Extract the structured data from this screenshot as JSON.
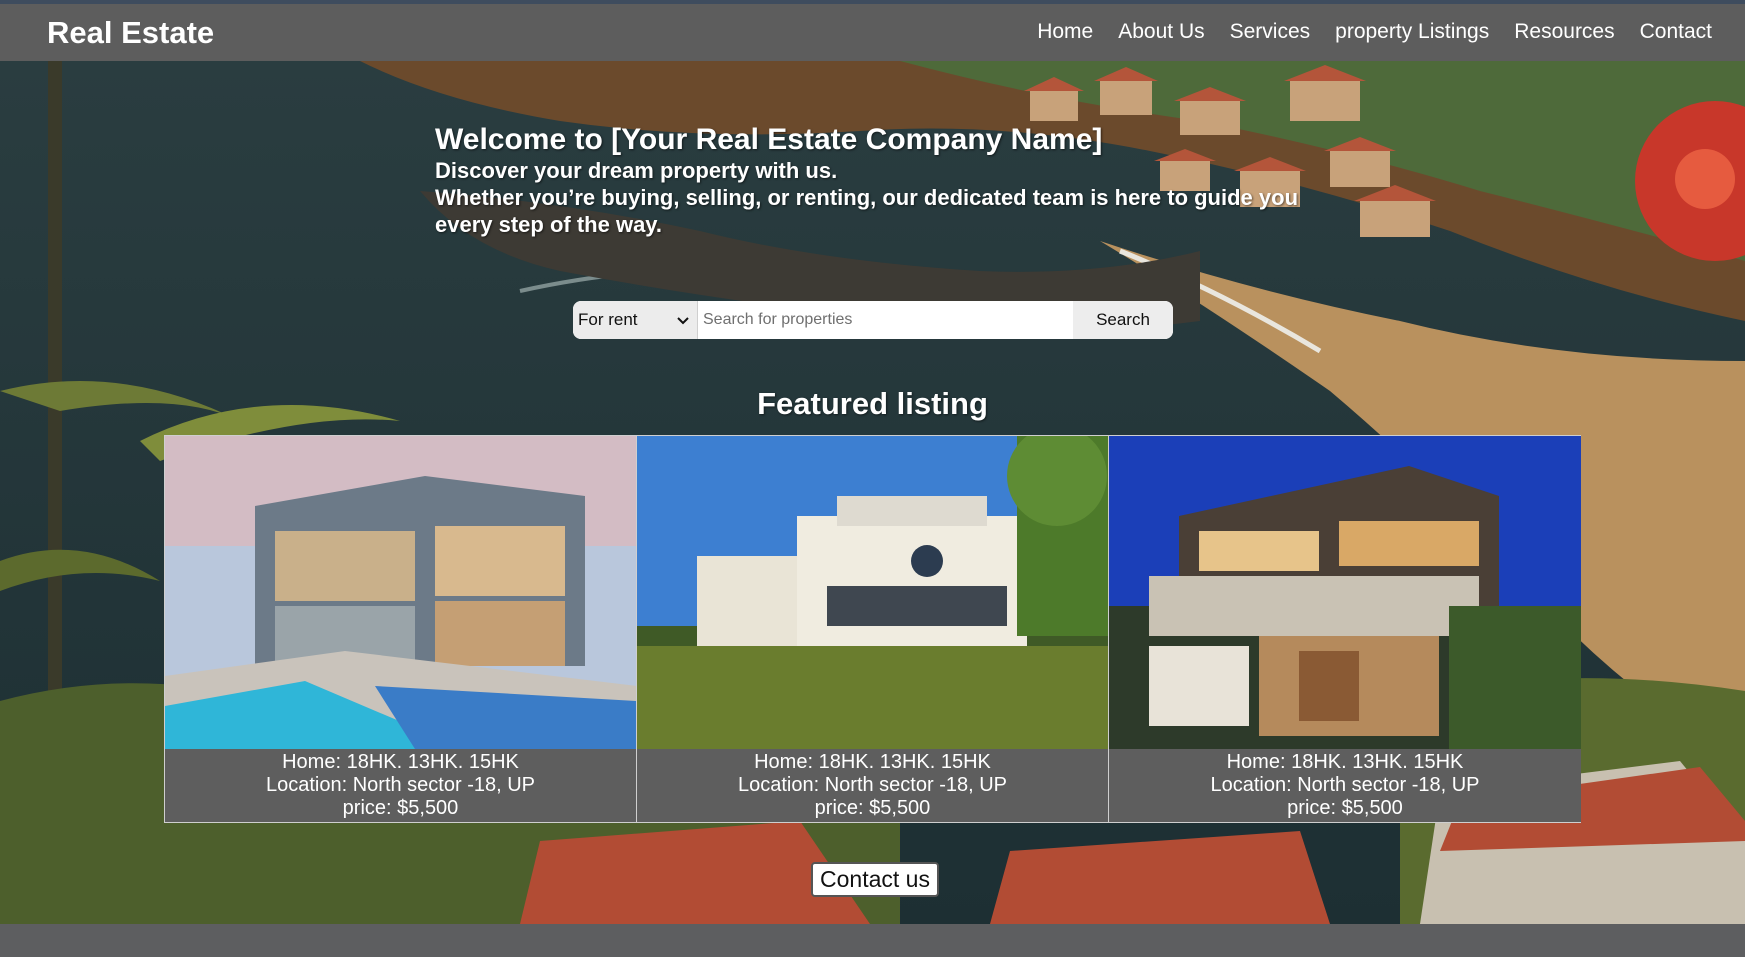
{
  "header": {
    "brand": "Real Estate",
    "nav": [
      "Home",
      "About Us",
      "Services",
      "property Listings",
      "Resources",
      "Contact"
    ]
  },
  "hero": {
    "title": "Welcome to [Your Real Estate Company Name]",
    "line1": "Discover your dream property with us.",
    "line2": "Whether you’re buying, selling, or renting, our dedicated team is here to guide you every step of the way."
  },
  "search": {
    "type_selected": "For rent",
    "placeholder": "Search for properties",
    "button": "Search"
  },
  "featured": {
    "title": "Featured listing",
    "cards": [
      {
        "home": "Home: 18HK. 13HK. 15HK",
        "location": "Location: North sector -18, UP",
        "price": "price: $5,500"
      },
      {
        "home": "Home: 18HK. 13HK. 15HK",
        "location": "Location: North sector -18, UP",
        "price": "price: $5,500"
      },
      {
        "home": "Home: 18HK. 13HK. 15HK",
        "location": "Location: North sector -18, UP",
        "price": "price: $5,500"
      }
    ]
  },
  "cta": {
    "contact": "Contact us"
  },
  "colors": {
    "navbar": "#5d5d5d",
    "card_info": "#5e5e5e",
    "text": "#ffffff"
  }
}
